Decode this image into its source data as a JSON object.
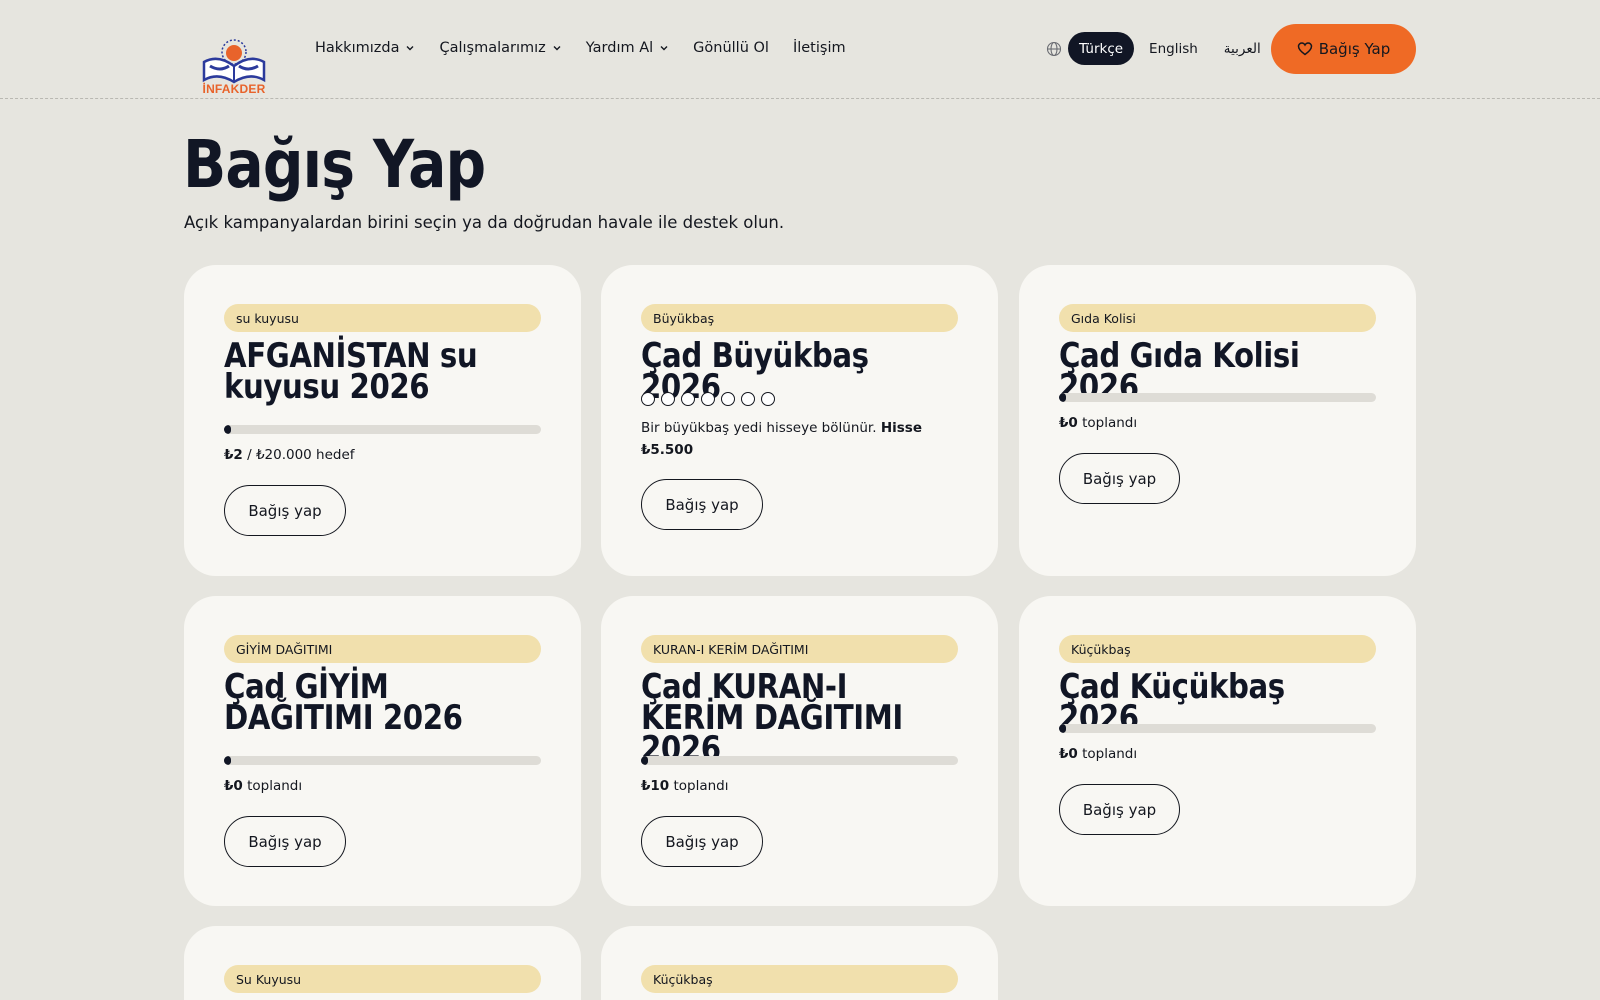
{
  "brand": {
    "logo_text": "İNFAKDER",
    "accent": "#ef6a25",
    "dark": "#111625"
  },
  "nav": [
    {
      "label": "Hakkımızda",
      "has_menu": true
    },
    {
      "label": "Çalışmalarımız",
      "has_menu": true
    },
    {
      "label": "Yardım Al",
      "has_menu": true
    },
    {
      "label": "Gönüllü Ol",
      "has_menu": false
    },
    {
      "label": "İletişim",
      "has_menu": false
    }
  ],
  "languages": {
    "icon": "globe-icon",
    "items": [
      "Türkçe",
      "English",
      "العربية"
    ],
    "active": "Türkçe"
  },
  "header_cta": {
    "label": "Bağış Yap",
    "icon": "heart-icon"
  },
  "page": {
    "title": "Bağış Yap",
    "subtitle": "Açık kampanyalardan birini seçin ya da doğrudan havale ile destek olun."
  },
  "cards": [
    {
      "tag": "su kuyusu",
      "title": "AFGANİSTAN su kuyusu 2026",
      "progress": 0.0001,
      "raised": "₺2",
      "sep": " / ",
      "goal": "₺20.000 hedef",
      "button": "Bağış yap"
    },
    {
      "tag": "Büyükbaş",
      "title": "Çad Büyükbaş 2026",
      "shares_total": 7,
      "shares_taken": 0,
      "note_text": "Bir büyükbaş yedi hisseye bölünür. ",
      "note_bold": "Hisse ₺5.500",
      "button": "Bağış yap"
    },
    {
      "tag": "Gıda Kolisi",
      "title": "Çad Gıda Kolisi 2026",
      "progress": 0,
      "raised": "₺0",
      "suffix": " toplandı",
      "button": "Bağış yap"
    },
    {
      "tag": "GİYİM DAĞITIMI",
      "title": "Çad GİYİM DAĞITIMI 2026",
      "progress": 0,
      "raised": "₺0",
      "suffix": " toplandı",
      "button": "Bağış yap"
    },
    {
      "tag": "KURAN-I KERİM DAĞITIMI",
      "title": "Çad KURAN-I KERİM DAĞITIMI 2026",
      "progress": 0,
      "raised": "₺10",
      "suffix": " toplandı",
      "button": "Bağış yap"
    },
    {
      "tag": "Küçükbaş",
      "title": "Çad Küçükbaş 2026",
      "progress": 0,
      "raised": "₺0",
      "suffix": " toplandı",
      "button": "Bağış yap"
    },
    {
      "tag": "Su Kuyusu"
    },
    {
      "tag": "Küçükbaş"
    }
  ]
}
